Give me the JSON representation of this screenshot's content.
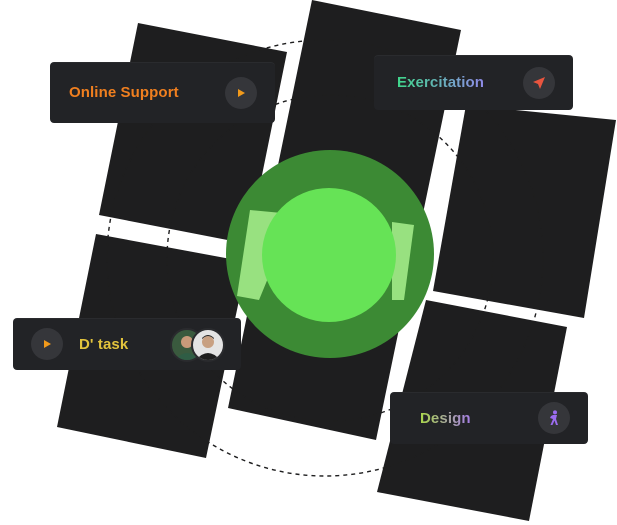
{
  "colors": {
    "panel": "#1e1e1f",
    "card": "#222326",
    "icon_bg": "#35363a",
    "accent_green": "#66e356",
    "dark_green": "#3c8a34",
    "light_green": "#a8f08e",
    "orange": "#e8761c",
    "play_orange": "#f29a1b",
    "arrow_red": "#e9553f",
    "figure_purple": "#9c6cf0"
  },
  "cards": {
    "online_support": {
      "label": "Online Support",
      "icon": "play-icon",
      "color": "#f07f1f"
    },
    "exercitation": {
      "label": "Exercitation",
      "icon": "navigation-arrow-icon",
      "gradient": [
        "#3fd68a",
        "#8f8ae8"
      ]
    },
    "d_task": {
      "label": "D' task",
      "icon": "play-icon",
      "color": "#e2c33c",
      "avatars": [
        "avatar-1",
        "avatar-2"
      ]
    },
    "design": {
      "label": "Design",
      "icon": "person-icon",
      "gradient": [
        "#a9d64a",
        "#a67de8"
      ]
    }
  }
}
